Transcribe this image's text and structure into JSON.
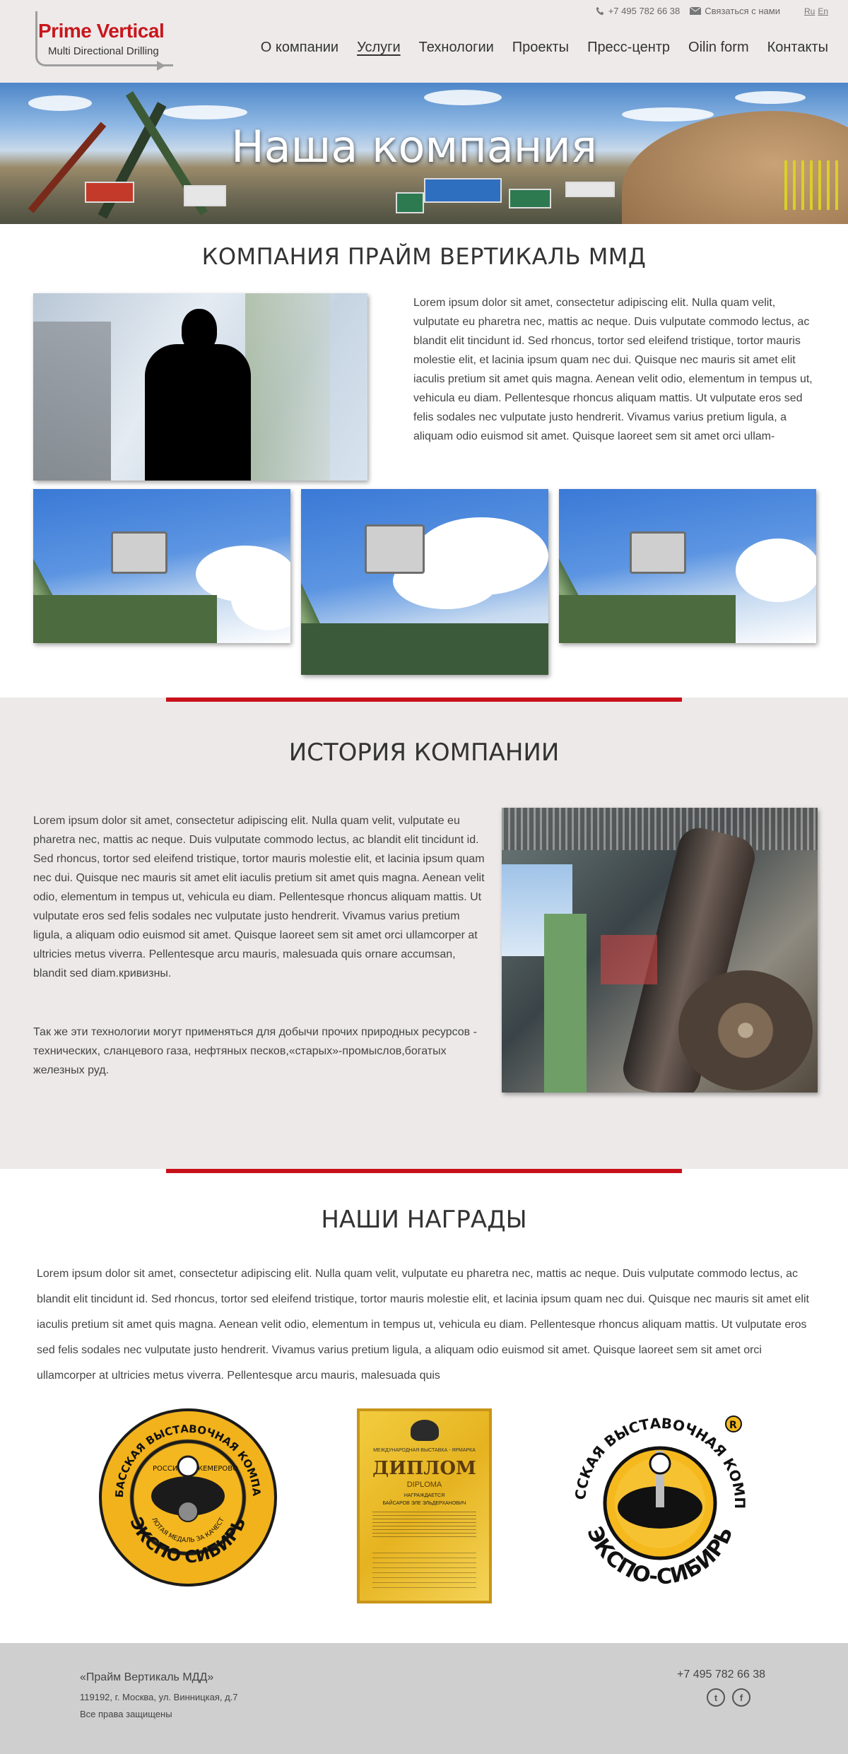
{
  "header": {
    "logo": {
      "title": "Prime Vertical",
      "subtitle": "Multi Directional Drilling"
    },
    "phone": "+7 495 782 66 38",
    "contact_link": "Связаться с нами",
    "langs": [
      "Ru",
      "En"
    ],
    "nav": [
      {
        "label": "О компании",
        "active": false
      },
      {
        "label": "Услуги",
        "active": true
      },
      {
        "label": "Технологии",
        "active": false
      },
      {
        "label": "Проекты",
        "active": false
      },
      {
        "label": "Пресс-центр",
        "active": false
      },
      {
        "label": "Oilin form",
        "active": false
      },
      {
        "label": "Контакты",
        "active": false
      }
    ]
  },
  "hero": {
    "title": "Наша компания"
  },
  "company": {
    "heading": "КОМПАНИЯ ПРАЙМ ВЕРТИКАЛЬ ММД",
    "text": "Lorem ipsum dolor sit amet, consectetur adipiscing elit. Nulla quam velit, vulputate eu pharetra nec, mattis ac neque. Duis vulputate commodo lectus, ac blandit elit tincidunt id. Sed rhoncus, tortor sed eleifend tristique, tortor mauris molestie elit, et lacinia ipsum quam nec dui. Quisque nec mauris sit amet elit iaculis pretium sit amet quis magna. Aenean velit odio, elementum in tempus ut, vehicula eu diam. Pellentesque rhoncus aliquam mattis. Ut vulputate eros sed felis sodales nec vulputate justo hendrerit. Vivamus varius pretium ligula, a aliquam odio euismod sit amet. Quisque laoreet sem sit amet orci ullam-"
  },
  "history": {
    "heading": "ИСТОРИЯ КОМПАНИИ",
    "text1": "Lorem ipsum dolor sit amet, consectetur adipiscing elit. Nulla quam velit, vulputate eu pharetra nec, mattis ac neque. Duis vulputate commodo lectus, ac blandit elit tincidunt id. Sed rhoncus, tortor sed eleifend tristique, tortor mauris molestie elit, et lacinia ipsum quam nec dui. Quisque nec mauris sit amet elit iaculis pretium sit amet quis magna. Aenean velit odio, elementum in tempus ut, vehicula eu diam. Pellentesque rhoncus aliquam mattis. Ut vulputate eros sed felis sodales nec vulputate justo hendrerit. Vivamus varius pretium ligula, a aliquam odio euismod sit amet. Quisque laoreet sem sit amet orci ullamcorper at ultricies metus viverra. Pellentesque arcu mauris, malesuada quis ornare accumsan, blandit sed diam.кривизны.",
    "text2": "Так же эти технологии могут применяться для добычи прочих природных ресурсов - технических, сланцевого газа, нефтяных песков,«старых»-промыслов,богатых железных руд."
  },
  "awards": {
    "heading": "НАШИ НАГРАДЫ",
    "text": "Lorem ipsum dolor sit amet, consectetur adipiscing elit. Nulla quam velit, vulputate eu pharetra nec, mattis ac neque. Duis vulputate commodo lectus, ac blandit elit tincidunt id. Sed rhoncus, tortor sed eleifend tristique, tortor mauris molestie elit, et lacinia ipsum quam nec dui. Quisque nec mauris sit amet elit iaculis pretium sit amet quis magna. Aenean velit odio, elementum in tempus ut, vehicula eu diam. Pellentesque rhoncus aliquam mattis. Ut vulputate eros sed felis sodales nec vulputate justo hendrerit. Vivamus varius pretium ligula, a aliquam odio euismod sit amet. Quisque laoreet sem sit amet orci ullamcorper at ultricies metus viverra. Pellentesque arcu mauris, malesuada quis",
    "medal1": {
      "top": "КУЗБАССКАЯ ВЫСТАВОЧНАЯ КОМПАНИЯ",
      "bottom": "ЭКСПО СИБИРЬ",
      "inner": "ЗОЛОТАЯ МЕДАЛЬ ЗА КАЧЕСТВО",
      "left": "РОССИЯ",
      "right": "КЕМЕРОВО"
    },
    "diploma": {
      "top": "МЕЖДУНАРОДНАЯ ВЫСТАВКА - ЯРМАРКА",
      "title": "ДИПЛОМ",
      "sub": "DIPLOMA",
      "awarded": "НАГРАЖДАЕТСЯ",
      "name": "БАЙСАРОВ ЭЛЕ ЭЛЬДЕРХАНОВИЧ"
    },
    "medal2": {
      "top": "КУЗБАССКАЯ ВЫСТАВОЧНАЯ КОМПАНИЯ",
      "bottom": "ЭКСПО-СИБИРЬ",
      "mark": "R"
    }
  },
  "footer": {
    "company": "«Прайм Вертикаль МДД»",
    "address": "119192, г. Москва, ул. Винницкая, д.7",
    "rights": "Все права защищены",
    "phone": "+7 495 782 66 38",
    "social": [
      {
        "name": "twitter-icon",
        "glyph": "t"
      },
      {
        "name": "facebook-icon",
        "glyph": "f"
      }
    ]
  }
}
